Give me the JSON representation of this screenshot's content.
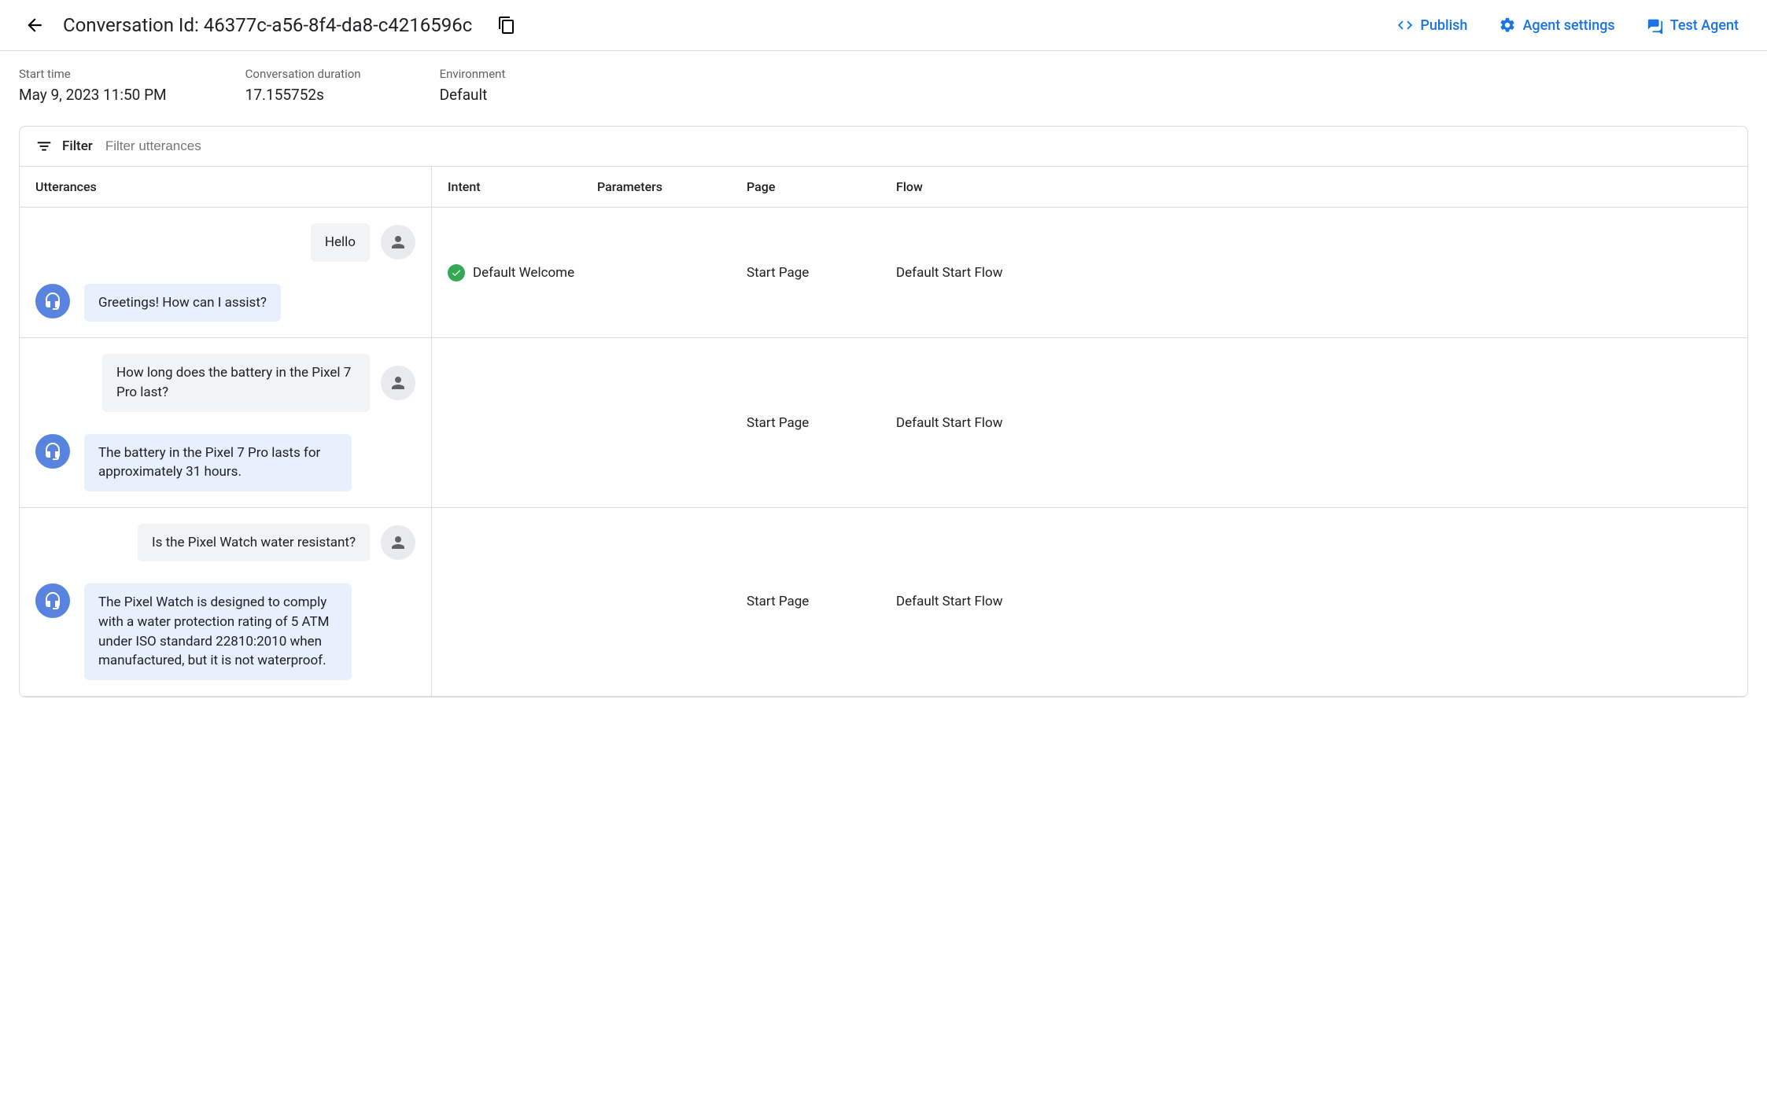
{
  "header": {
    "title": "Conversation Id: 46377c-a56-8f4-da8-c4216596c",
    "actions": {
      "publish": "Publish",
      "agent_settings": "Agent settings",
      "test_agent": "Test Agent"
    }
  },
  "meta": {
    "start_time_label": "Start time",
    "start_time_value": "May 9, 2023 11:50 PM",
    "duration_label": "Conversation duration",
    "duration_value": "17.155752s",
    "environment_label": "Environment",
    "environment_value": "Default"
  },
  "filter": {
    "label": "Filter",
    "placeholder": "Filter utterances"
  },
  "columns": {
    "utterances": "Utterances",
    "intent": "Intent",
    "parameters": "Parameters",
    "page": "Page",
    "flow": "Flow"
  },
  "rows": [
    {
      "user": "Hello",
      "agent": "Greetings! How can I assist?",
      "intent": "Default Welcome",
      "intent_matched": true,
      "parameters": "",
      "page": "Start Page",
      "flow": "Default Start Flow"
    },
    {
      "user": "How long does the battery in the Pixel 7 Pro last?",
      "agent": "The battery in the Pixel 7 Pro lasts for approximately 31 hours.",
      "intent": "",
      "intent_matched": false,
      "parameters": "",
      "page": "Start Page",
      "flow": "Default Start Flow"
    },
    {
      "user": "Is the Pixel Watch water resistant?",
      "agent": "The Pixel Watch is designed to comply with a water protection rating of 5 ATM under ISO standard 22810:2010 when manufactured, but it is not waterproof.",
      "intent": "",
      "intent_matched": false,
      "parameters": "",
      "page": "Start Page",
      "flow": "Default Start Flow"
    }
  ]
}
